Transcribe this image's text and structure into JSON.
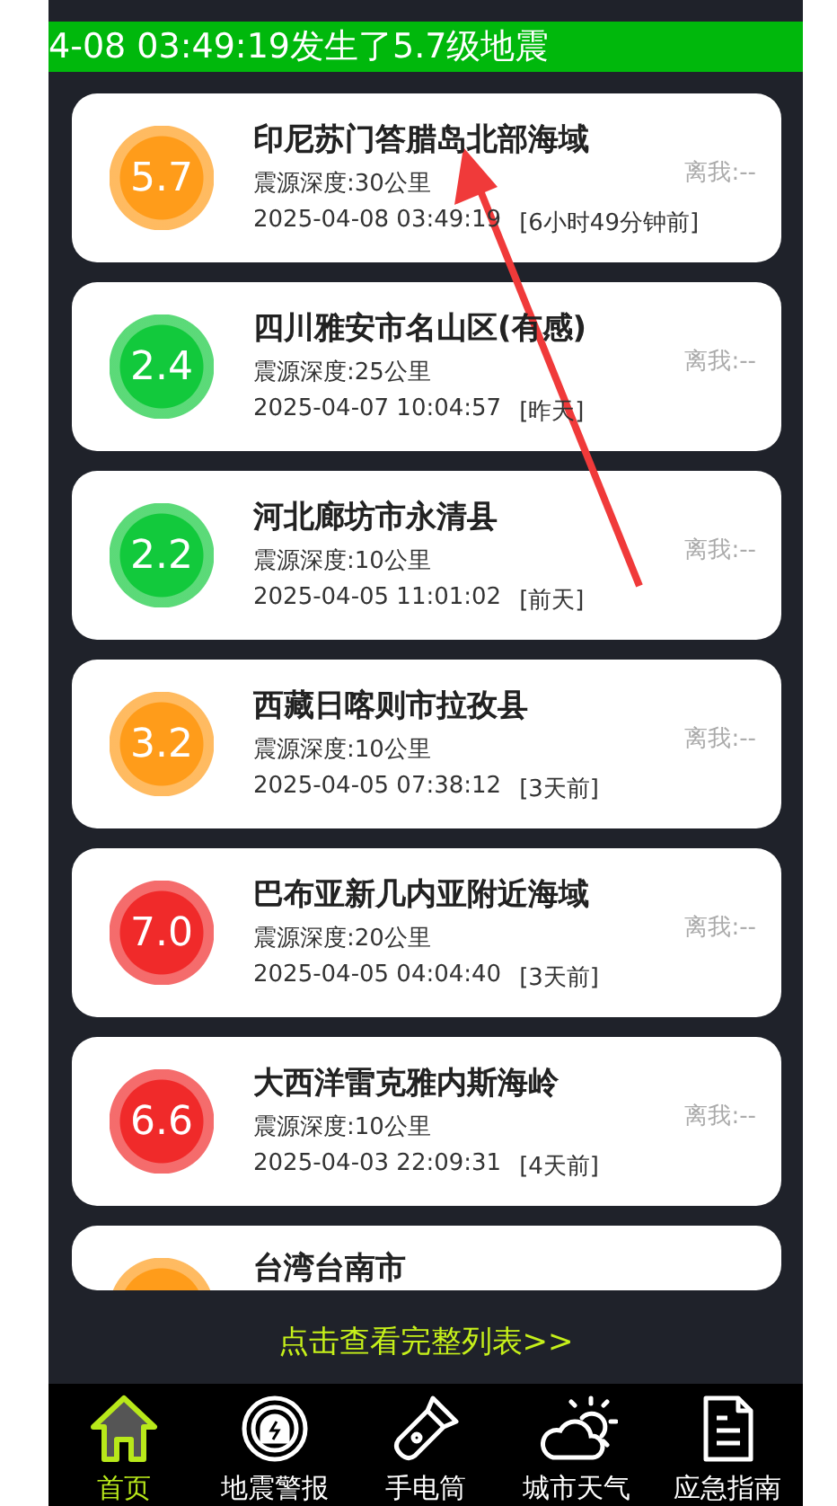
{
  "banner": {
    "text": "4-08 03:49:19发生了5.7级地震"
  },
  "quakes": [
    {
      "magnitude": "5.7",
      "color": "#ff9c1a",
      "place": "印尼苏门答腊岛北部海域",
      "depth": "震源深度:30公里",
      "time": "2025-04-08 03:49:19",
      "ago": "[6小时49分钟前]",
      "distance": "离我:--"
    },
    {
      "magnitude": "2.4",
      "color": "#12c93c",
      "place": "四川雅安市名山区(有感)",
      "depth": "震源深度:25公里",
      "time": "2025-04-07 10:04:57",
      "ago": "[昨天]",
      "distance": "离我:--"
    },
    {
      "magnitude": "2.2",
      "color": "#12c93c",
      "place": "河北廊坊市永清县",
      "depth": "震源深度:10公里",
      "time": "2025-04-05 11:01:02",
      "ago": "[前天]",
      "distance": "离我:--"
    },
    {
      "magnitude": "3.2",
      "color": "#ff9c1a",
      "place": "西藏日喀则市拉孜县",
      "depth": "震源深度:10公里",
      "time": "2025-04-05 07:38:12",
      "ago": "[3天前]",
      "distance": "离我:--"
    },
    {
      "magnitude": "7.0",
      "color": "#f02a2a",
      "place": "巴布亚新几内亚附近海域",
      "depth": "震源深度:20公里",
      "time": "2025-04-05 04:04:40",
      "ago": "[3天前]",
      "distance": "离我:--"
    },
    {
      "magnitude": "6.6",
      "color": "#f02a2a",
      "place": "大西洋雷克雅内斯海岭",
      "depth": "震源深度:10公里",
      "time": "2025-04-03 22:09:31",
      "ago": "[4天前]",
      "distance": "离我:--"
    },
    {
      "color": "#ff9c1a",
      "place": "台湾台南市"
    }
  ],
  "more_link": "点击查看完整列表>>",
  "nav": [
    {
      "kind": "home",
      "label": "首页",
      "selected": true
    },
    {
      "kind": "alarm",
      "label": "地震警报",
      "selected": false
    },
    {
      "kind": "flashlight",
      "label": "手电筒",
      "selected": false
    },
    {
      "kind": "weather",
      "label": "城市天气",
      "selected": false
    },
    {
      "kind": "guide",
      "label": "应急指南",
      "selected": false
    }
  ]
}
